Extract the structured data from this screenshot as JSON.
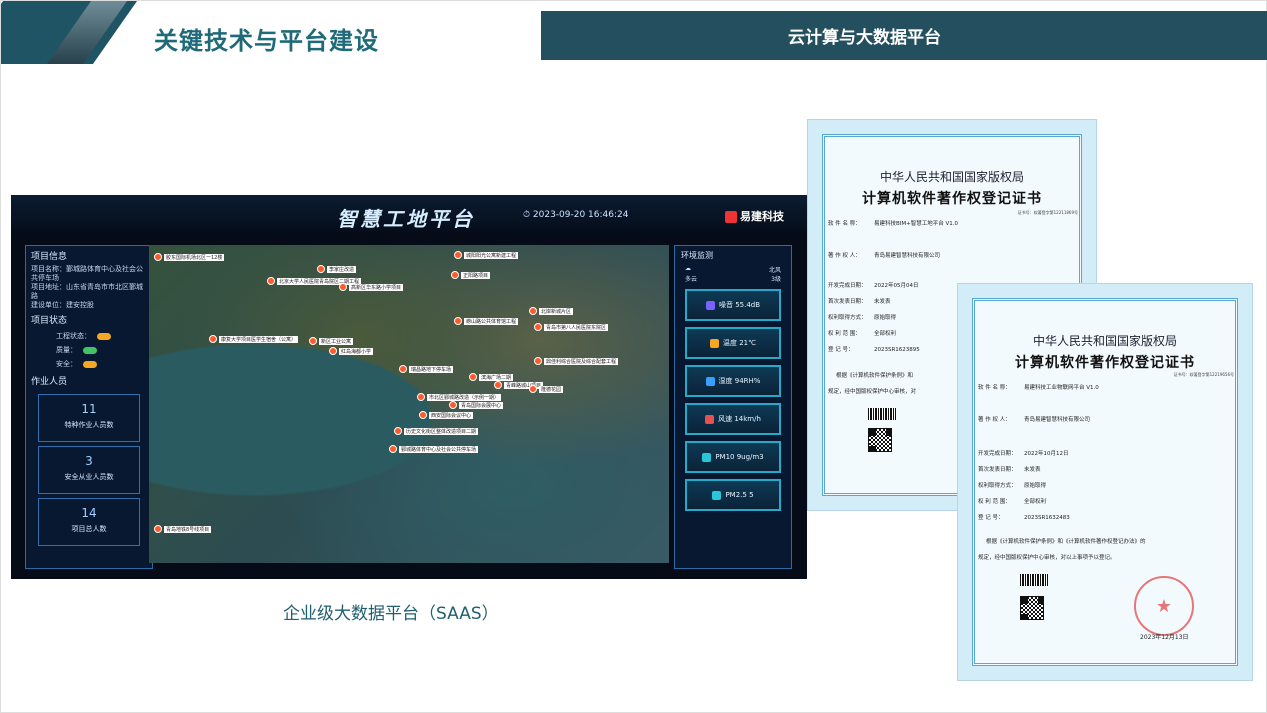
{
  "header": {
    "title": "关键技术与平台建设",
    "banner": "云计算与大数据平台"
  },
  "dashboard": {
    "title": "智慧工地平台",
    "time": "2023-09-20 16:46:24",
    "brand": "易建科技",
    "project_info": {
      "heading": "项目信息",
      "name": "项目名称：鄞城路体育中心及社会公共停车场",
      "address": "项目地址：山东省青岛市市北区鄞城路",
      "unit": "建设单位：建安控股"
    },
    "project_status": {
      "heading": "项目状态",
      "items": [
        {
          "label": "工程状态：",
          "color": "#f5a623"
        },
        {
          "label": "质量：",
          "color": "#44c267"
        },
        {
          "label": "安全：",
          "color": "#f5a623"
        }
      ]
    },
    "workers": {
      "heading": "作业人员",
      "cards": [
        {
          "num": "11",
          "label": "特种作业人员数"
        },
        {
          "num": "3",
          "label": "安全从业人员数"
        },
        {
          "num": "14",
          "label": "项目总人数"
        }
      ]
    },
    "env": {
      "heading": "环境监测",
      "weather": "多云",
      "wind": "北风",
      "level": "3级",
      "cards": [
        {
          "label": "噪音 55.4dB",
          "color": "#7b61ff"
        },
        {
          "label": "温度 21℃",
          "color": "#f5a623"
        },
        {
          "label": "湿度 94RH%",
          "color": "#3aa0ff"
        },
        {
          "label": "风速 14km/h",
          "color": "#e85050"
        },
        {
          "label": "PM10 9ug/m3",
          "color": "#29c7d8"
        },
        {
          "label": "PM2.5 5",
          "color": "#29c7d8"
        }
      ]
    },
    "map_pins": [
      "胶东国际机场北区一12楼",
      "城阳阳光公寓新建工程",
      "李家庄改造",
      "北京大学人民医院青岛院区二期工程",
      "正阳路项目",
      "高新区华东路小学项目",
      "北岸新城片区",
      "崂山路公共体育馆工程",
      "青岛市第八人民医院东院区",
      "康复大学项目医学生宿舍（公寓）",
      "新区工业公寓",
      "红岛海都小学",
      "鼎佳利综合医院及综合配套工程",
      "瑞昌路地下停车场",
      "滨海广场二期",
      "青峰路城山项目",
      "市北区鄞城路改造（示例一期）",
      "青岛国际会展中心",
      "隆德花园",
      "西安国际会议中心",
      "历史文化街区整体改造项目二期",
      "鄞城路体育中心及社会公共停车场",
      "青岛地铁8号线项目"
    ]
  },
  "caption": "企业级大数据平台（SAAS）",
  "cert1": {
    "t1": "中华人民共和国国家版权局",
    "t2": "计算机软件著作权登记证书",
    "no": "证书号：软著登字第12211869号",
    "rows": [
      [
        "软 件 名 称：",
        "易建科技BIM+智慧工地平台 V1.0"
      ],
      [
        "著 作 权 人：",
        "青岛易建智慧科技有限公司"
      ],
      [
        "开发完成日期：",
        "2022年05月04日"
      ],
      [
        "首次发表日期：",
        "未发表"
      ],
      [
        "权利取得方式：",
        "原始取得"
      ],
      [
        "权 利 范 围：",
        "全部权利"
      ],
      [
        "登 记 号：",
        "2023SR1623895"
      ]
    ],
    "note1": "根据《计算机软件保护条例》和",
    "note2": "规定，经中国版权保护中心审核，对"
  },
  "cert2": {
    "t1": "中华人民共和国国家版权局",
    "t2": "计算机软件著作权登记证书",
    "no": "证书号：软著登字第12219656号",
    "rows": [
      [
        "软 件 名 称：",
        "易建科技工业物联网平台 V1.0"
      ],
      [
        "著 作 权 人：",
        "青岛易建智慧科技有限公司"
      ],
      [
        "开发完成日期：",
        "2022年10月12日"
      ],
      [
        "首次发表日期：",
        "未发表"
      ],
      [
        "权利取得方式：",
        "原始取得"
      ],
      [
        "权 利 范 围：",
        "全部权利"
      ],
      [
        "登 记 号：",
        "2023SR1632483"
      ]
    ],
    "note1": "根据《计算机软件保护条例》和《计算机软件著作权登记办法》的",
    "note2": "规定，经中国版权保护中心审核，对以上事项予以登记。",
    "date": "2023年12月13日"
  },
  "colors": {
    "accent": "#234f5f",
    "title": "#1f6a78"
  }
}
